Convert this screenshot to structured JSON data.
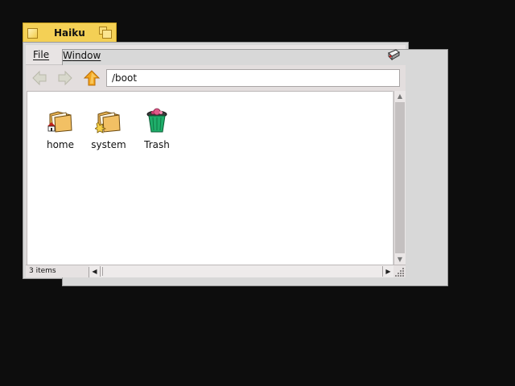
{
  "window": {
    "title": "Haiku",
    "tab_color": "#f4d055"
  },
  "menubar": {
    "file": {
      "mnemonic": "F",
      "rest": "ile"
    },
    "window": {
      "mnemonic": "W",
      "rest": "indow"
    },
    "right_icon": "drive-icon"
  },
  "toolbar": {
    "back_icon": "back-arrow-icon",
    "forward_icon": "forward-arrow-icon",
    "up_icon": "up-arrow-icon",
    "location": "/boot"
  },
  "content": {
    "items": [
      {
        "label": "home",
        "icon": "home-folder-icon"
      },
      {
        "label": "system",
        "icon": "system-folder-icon"
      },
      {
        "label": "Trash",
        "icon": "trash-icon"
      }
    ]
  },
  "statusbar": {
    "count": "3 items"
  },
  "colors": {
    "desktop": "#0d0d0d",
    "accent_yellow": "#f4d055",
    "nav_up": "#f2a31b"
  }
}
